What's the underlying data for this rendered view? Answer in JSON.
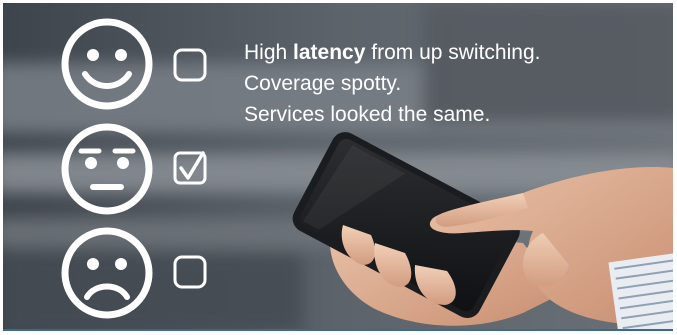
{
  "feedback": {
    "line1_before": "High ",
    "line1_emphasis": "latency",
    "line1_after": " from up switching.",
    "line2": "Coverage spotty.",
    "line3": "Services looked the same."
  },
  "ratings": [
    {
      "face": "happy-face-icon",
      "checked": false
    },
    {
      "face": "neutral-face-icon",
      "checked": true
    },
    {
      "face": "sad-face-icon",
      "checked": false
    }
  ],
  "colors": {
    "icon_stroke": "#ffffff",
    "text": "#ffffff",
    "bottom_rule": "#3a6a8f"
  }
}
